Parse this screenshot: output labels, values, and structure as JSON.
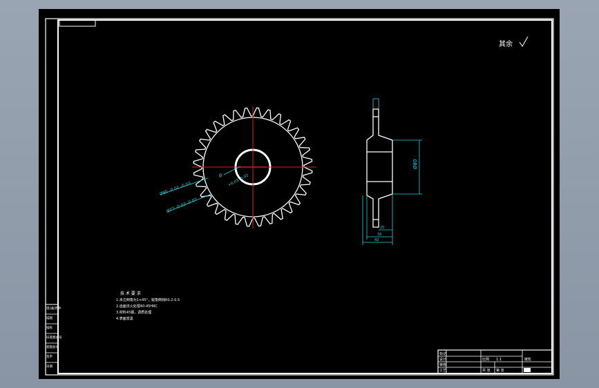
{
  "drawing": {
    "surface_mark": "其余",
    "side_view": {
      "dim_diameter": "Ø80",
      "dim_hub_width": "25",
      "dim_mid_width": "33",
      "dim_total_width": "42"
    },
    "front_view": {
      "dim_bore": "Ø",
      "dim_bore_tol": "+0.03\n-0.02",
      "dim_outer_a": "Ø95 -0.01\n-0.03",
      "dim_outer_b": "Ø77 -0.03\n-0.07"
    },
    "tech_requirements": {
      "title": "技 术 要 求",
      "lines": [
        "1.未注倒角为1×45°，锐角倒钝R0.2-0.5",
        "2.齿面淬火处理40-45HRC",
        "3.材料45钢，调质处理",
        "4.表面发黑"
      ]
    },
    "left_column": [
      "借(通)用件",
      "描图",
      "描校",
      "旧底图总号",
      "底图总号",
      "签字",
      "日期"
    ],
    "title_block": {
      "row1": [
        "标记"
      ],
      "row2": [
        "设计"
      ],
      "row3": [
        "审核",
        "比例",
        "1:1"
      ],
      "row4": [
        "工艺",
        "共 张",
        "第 张"
      ],
      "label_part": "链轮"
    }
  },
  "colors": {
    "line": "#ffffff",
    "center": "#e01818",
    "dimension": "#1ad6e0",
    "background": "#000000",
    "desktop": "#8f9aa8"
  }
}
